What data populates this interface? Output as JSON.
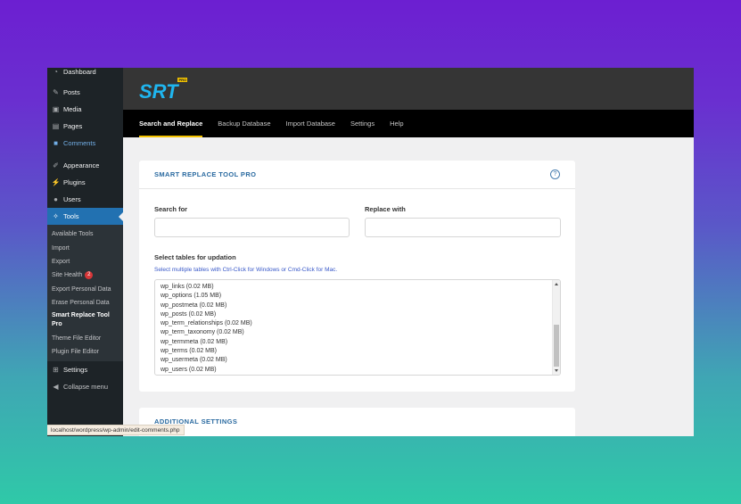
{
  "sidebar": {
    "items": [
      {
        "label": "Dashboard",
        "icon": "dashboard-icon"
      },
      {
        "label": "Posts",
        "icon": "pin-icon"
      },
      {
        "label": "Media",
        "icon": "media-icon"
      },
      {
        "label": "Pages",
        "icon": "page-icon"
      },
      {
        "label": "Comments",
        "icon": "comment-icon"
      },
      {
        "label": "Appearance",
        "icon": "brush-icon"
      },
      {
        "label": "Plugins",
        "icon": "plug-icon"
      },
      {
        "label": "Users",
        "icon": "user-icon"
      },
      {
        "label": "Tools",
        "icon": "wrench-icon"
      },
      {
        "label": "Settings",
        "icon": "settings-icon"
      },
      {
        "label": "Collapse menu",
        "icon": "collapse-icon"
      }
    ],
    "tools_submenu": [
      {
        "label": "Available Tools"
      },
      {
        "label": "Import"
      },
      {
        "label": "Export"
      },
      {
        "label": "Site Health",
        "badge": "2"
      },
      {
        "label": "Export Personal Data"
      },
      {
        "label": "Erase Personal Data"
      },
      {
        "label": "Smart Replace Tool Pro"
      },
      {
        "label": "Theme File Editor"
      },
      {
        "label": "Plugin File Editor"
      }
    ]
  },
  "brand": {
    "logo_text": "SRT",
    "logo_badge": "PRO"
  },
  "tabs": [
    "Search and Replace",
    "Backup Database",
    "Import Database",
    "Settings",
    "Help"
  ],
  "main_card": {
    "title": "SMART REPLACE TOOL PRO",
    "help_glyph": "?",
    "search_label": "Search for",
    "search_value": "",
    "replace_label": "Replace with",
    "replace_value": "",
    "tables_label": "Select tables for updation",
    "tables_hint": "Select multiple tables with Ctrl-Click for Windows or Cmd-Click for Mac.",
    "tables": [
      "wp_links (0.02 MB)",
      "wp_options (1.05 MB)",
      "wp_postmeta (0.02 MB)",
      "wp_posts (0.02 MB)",
      "wp_term_relationships (0.02 MB)",
      "wp_term_taxonomy (0.02 MB)",
      "wp_termmeta (0.02 MB)",
      "wp_terms (0.02 MB)",
      "wp_usermeta (0.02 MB)",
      "wp_users (0.02 MB)"
    ]
  },
  "additional_card": {
    "title": "ADDITIONAL SETTINGS"
  },
  "status_url": "localhost/wordpress/wp-admin/edit-comments.php",
  "colors": {
    "accent": "#2271b1",
    "tab_underline": "#f2c200",
    "logo_blue": "#1fb6f0"
  }
}
